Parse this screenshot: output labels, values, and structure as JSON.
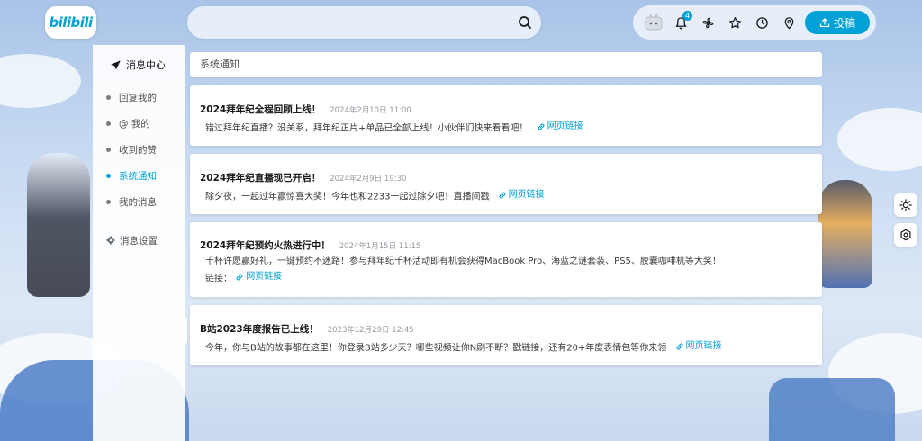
{
  "brand": {
    "logo_text": "bilibili",
    "accent": "#00a1d6"
  },
  "header": {
    "search": {
      "placeholder": ""
    },
    "notification_count": "4",
    "upload_label": "投稿"
  },
  "sidebar": {
    "title": "消息中心",
    "items": [
      {
        "label": "回复我的"
      },
      {
        "label": "@ 我的"
      },
      {
        "label": "收到的赞"
      },
      {
        "label": "系统通知"
      },
      {
        "label": "我的消息"
      }
    ],
    "active_index": 3,
    "settings_label": "消息设置"
  },
  "main": {
    "section_title": "系统通知",
    "notices": [
      {
        "title": "2024拜年纪全程回顾上线！",
        "time": "2024年2月10日 11:00",
        "lines": [
          "错过拜年纪直播？没关系，拜年纪正片+单品已全部上线！小伙伴们快来看看吧！"
        ],
        "link_label": "网页链接"
      },
      {
        "title": "2024拜年纪直播现已开启！",
        "time": "2024年2月9日 19:30",
        "lines": [
          "除夕夜，一起过年赢惊喜大奖！今年也和2233一起过除夕吧！直播间戳"
        ],
        "link_label": "网页链接"
      },
      {
        "title": "2024拜年纪预约火热进行中！",
        "time": "2024年1月15日 11:15",
        "lines": [
          "千杯许愿赢好礼，一键预约不迷路！参与拜年纪千杯活动即有机会获得MacBook Pro、海蓝之谜套装、PS5、胶囊咖啡机等大奖！",
          "链接："
        ],
        "link_label": "网页链接"
      },
      {
        "title": "B站2023年度报告已上线！",
        "time": "2023年12月29日 12:45",
        "lines": [
          "今年，你与B站的故事都在这里！你登录B站多少天？哪些视频让你N刷不断？戳链接，还有20+年度表情包等你来领"
        ],
        "link_label": "网页链接"
      }
    ]
  }
}
